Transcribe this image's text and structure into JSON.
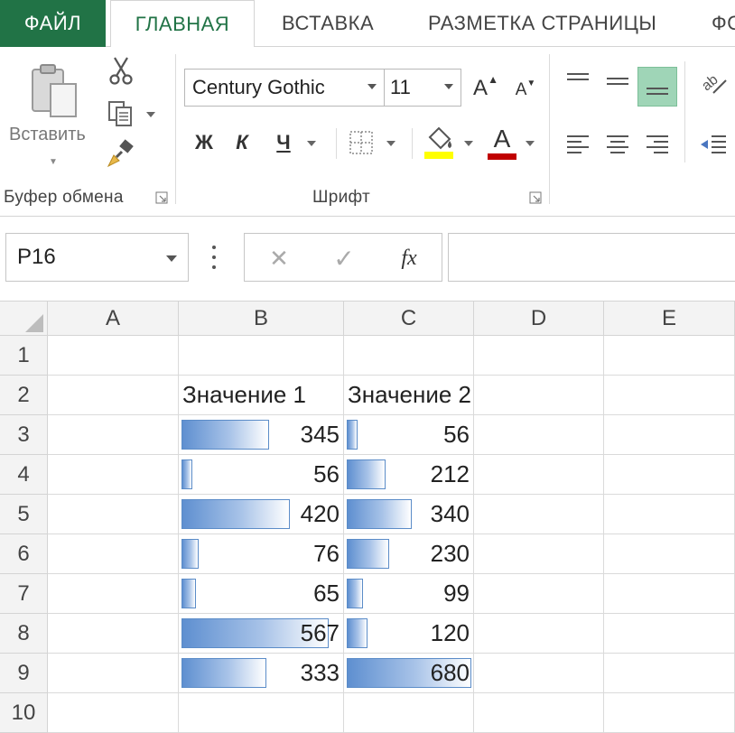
{
  "ribbon_tabs": {
    "file": "ФАЙЛ",
    "home": "ГЛАВНАЯ",
    "insert": "ВСТАВКА",
    "page_layout": "РАЗМЕТКА СТРАНИЦЫ",
    "formulas_partial": "ФО"
  },
  "clipboard": {
    "paste_label": "Вставить",
    "group_label": "Буфер обмена"
  },
  "font": {
    "font_name": "Century Gothic",
    "font_size": "11",
    "bold_label": "Ж",
    "italic_label": "К",
    "underline_label": "Ч",
    "grow_label": "A",
    "shrink_label": "A",
    "font_color_label": "A",
    "group_label": "Шрифт",
    "fill_color": "#ffff00",
    "font_color": "#c00000"
  },
  "formula_bar": {
    "name_box": "P16",
    "fx_label": "fx",
    "cancel_symbol": "✕",
    "enter_symbol": "✓",
    "formula_value": ""
  },
  "grid": {
    "columns": [
      "A",
      "B",
      "C",
      "D",
      "E"
    ],
    "rows": [
      "1",
      "2",
      "3",
      "4",
      "5",
      "6",
      "7",
      "8",
      "9",
      "10"
    ],
    "header_b2": "Значение 1",
    "header_c2": "Значение 2",
    "values_b": [
      "345",
      "56",
      "420",
      "76",
      "65",
      "567",
      "333"
    ],
    "values_c": [
      "56",
      "212",
      "340",
      "230",
      "99",
      "120",
      "680"
    ],
    "bar_fill_b": [
      0.55,
      0.07,
      0.68,
      0.11,
      0.09,
      0.92,
      0.53
    ],
    "bar_fill_c": [
      0.07,
      0.31,
      0.52,
      0.34,
      0.13,
      0.17,
      1.0
    ],
    "accent_color": "#217346",
    "data_bar_color": "#5e8fd0"
  }
}
